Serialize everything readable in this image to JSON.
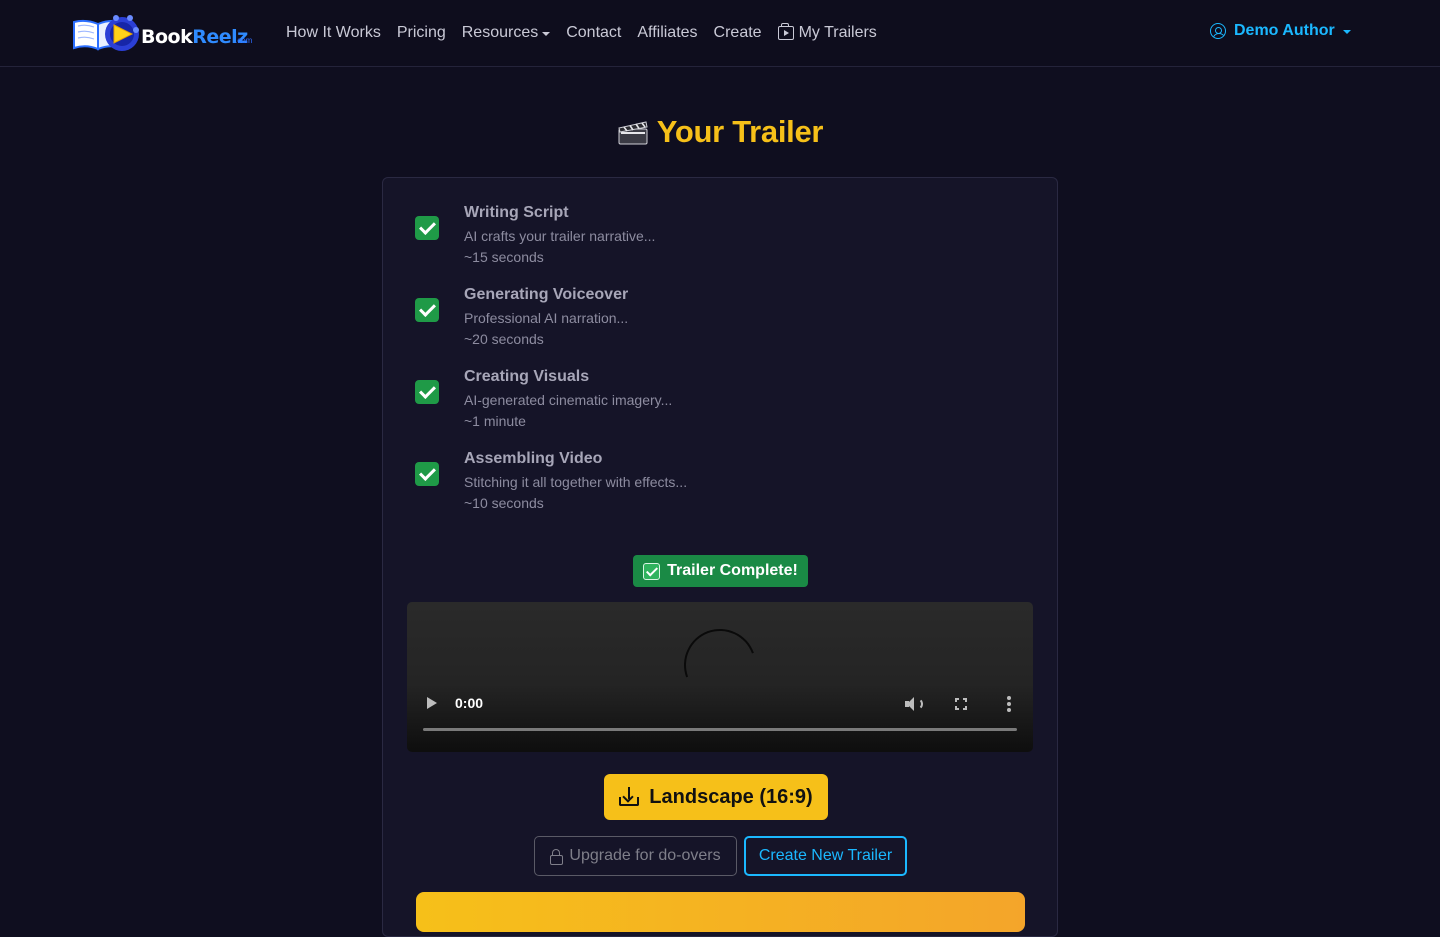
{
  "brand": {
    "name_part1": "Book",
    "name_part2": "Reelz",
    "suffix": ".com"
  },
  "nav": {
    "links": [
      "How It Works",
      "Pricing",
      "Resources",
      "Contact",
      "Affiliates",
      "Create",
      "My Trailers"
    ],
    "user": "Demo Author"
  },
  "page": {
    "title": "Your Trailer"
  },
  "steps": [
    {
      "title": "Writing Script",
      "desc": "AI crafts your trailer narrative...",
      "time": "~15 seconds"
    },
    {
      "title": "Generating Voiceover",
      "desc": "Professional AI narration...",
      "time": "~20 seconds"
    },
    {
      "title": "Creating Visuals",
      "desc": "AI-generated cinematic imagery...",
      "time": "~1 minute"
    },
    {
      "title": "Assembling Video",
      "desc": "Stitching it all together with effects...",
      "time": "~10 seconds"
    }
  ],
  "status": {
    "complete": "Trailer Complete!"
  },
  "video": {
    "time": "0:00",
    "progress": 0
  },
  "actions": {
    "download": "Landscape (16:9)",
    "upgrade": "Upgrade for do-overs",
    "create_new": "Create New Trailer"
  },
  "colors": {
    "accent_gold": "#f6c019",
    "accent_blue": "#1bb8ff",
    "success_green": "#1a8a45",
    "background": "#0f0e1f"
  }
}
